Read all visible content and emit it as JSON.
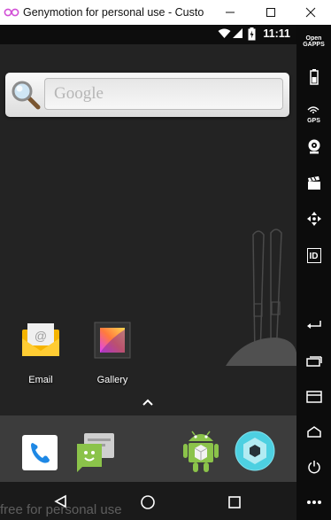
{
  "window": {
    "title": "Genymotion for personal use - Custo",
    "minimize": "minimize",
    "maximize": "maximize",
    "close": "close"
  },
  "statusbar": {
    "time": "11:11",
    "icons": [
      "wifi-icon",
      "signal-icon",
      "battery-icon"
    ]
  },
  "search": {
    "placeholder": "Google"
  },
  "home_apps": [
    {
      "label": "Email",
      "icon": "email-icon"
    },
    {
      "label": "Gallery",
      "icon": "gallery-icon"
    }
  ],
  "dock_apps": [
    "phone-icon",
    "messaging-icon",
    "app-drawer-icon",
    "camera-icon"
  ],
  "navbar": [
    "back-icon",
    "home-icon",
    "recents-icon"
  ],
  "watermark": "free for personal use",
  "sidebar": {
    "opengapps_line1": "Open",
    "opengapps_line2": "GAPPS",
    "gps_label": "GPS",
    "id_label": "ID"
  },
  "colors": {
    "screen_bg": "#232323",
    "dock_bg": "#3c3c3c",
    "sidebar_bg": "#0c0c0c",
    "title_icon": "#d24fd6"
  }
}
